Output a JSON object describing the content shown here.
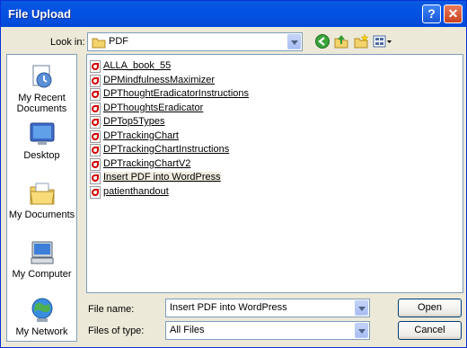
{
  "window": {
    "title": "File Upload"
  },
  "toolbar": {
    "look_in_label": "Look in:",
    "folder": "PDF"
  },
  "places": [
    {
      "label": "My Recent Documents",
      "icon": "recent-documents-icon"
    },
    {
      "label": "Desktop",
      "icon": "desktop-icon"
    },
    {
      "label": "My Documents",
      "icon": "my-documents-icon"
    },
    {
      "label": "My Computer",
      "icon": "my-computer-icon"
    },
    {
      "label": "My Network",
      "icon": "my-network-icon"
    }
  ],
  "files": [
    "ALLA_book_55",
    "DPMindfulnessMaximizer",
    "DPThoughtEradicatorInstructions",
    "DPThoughtsEradicator",
    "DPTop5Types",
    "DPTrackingChart",
    "DPTrackingChartInstructions",
    "DPTrackingChartV2",
    "Insert PDF into WordPress",
    "patienthandout"
  ],
  "selected_file_index": 8,
  "bottom": {
    "file_name_label": "File name:",
    "file_name_value": "Insert PDF into WordPress",
    "files_of_type_label": "Files of type:",
    "files_of_type_value": "All Files",
    "open_label": "Open",
    "cancel_label": "Cancel"
  }
}
